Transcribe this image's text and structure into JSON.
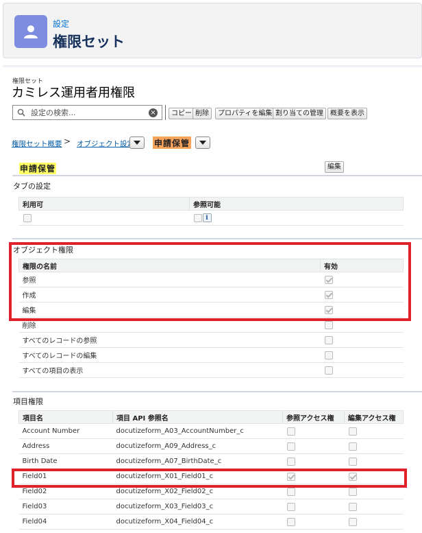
{
  "header": {
    "subtitle": "設定",
    "title": "権限セット"
  },
  "permission_set": {
    "label": "権限セット",
    "name": "カミレス運用者用権限"
  },
  "toolbar": {
    "search_placeholder": "設定の検索...",
    "buttons": [
      "コピー",
      "削除",
      "プロパティを編集",
      "割り当ての管理",
      "概要を表示"
    ]
  },
  "breadcrumb": {
    "item1": "権限セット概要",
    "item2": "オブジェクト設定",
    "current": "申請保管"
  },
  "object": {
    "name": "申請保管",
    "edit_label": "編集"
  },
  "tab_settings": {
    "title": "タブの設定",
    "col_available": "利用可",
    "col_visible": "参照可能",
    "info_icon_text": "i",
    "available_checked": false,
    "visible_checked": false
  },
  "object_permissions": {
    "title": "オブジェクト権限",
    "col_name": "権限の名前",
    "col_enabled": "有効",
    "rows": [
      {
        "name": "参照",
        "enabled": true
      },
      {
        "name": "作成",
        "enabled": true
      },
      {
        "name": "編集",
        "enabled": true
      },
      {
        "name": "削除",
        "enabled": false
      },
      {
        "name": "すべてのレコードの参照",
        "enabled": false
      },
      {
        "name": "すべてのレコードの編集",
        "enabled": false
      },
      {
        "name": "すべての項目の表示",
        "enabled": false
      }
    ]
  },
  "field_permissions": {
    "title": "項目権限",
    "col_field": "項目名",
    "col_api": "項目 API 参照名",
    "col_read": "参照アクセス権",
    "col_edit": "編集アクセス権",
    "rows": [
      {
        "field": "Account Number",
        "api": "docutizeform_A03_AccountNumber_c",
        "read": false,
        "edit": false
      },
      {
        "field": "Address",
        "api": "docutizeform_A09_Address_c",
        "read": false,
        "edit": false
      },
      {
        "field": "Birth Date",
        "api": "docutizeform_A07_BirthDate_c",
        "read": false,
        "edit": false
      },
      {
        "field": "Field01",
        "api": "docutizeform_X01_Field01_c",
        "read": true,
        "edit": true
      },
      {
        "field": "Field02",
        "api": "docutizeform_X02_Field02_c",
        "read": false,
        "edit": false
      },
      {
        "field": "Field03",
        "api": "docutizeform_X03_Field03_c",
        "read": false,
        "edit": false
      },
      {
        "field": "Field04",
        "api": "docutizeform_X04_Field04_c",
        "read": false,
        "edit": false
      }
    ]
  },
  "colors": {
    "highlight_box": "#e0202a",
    "header_icon_bg": "#7f8de1",
    "breadcrumb_current_bg": "#f7a35c",
    "object_name_bg": "#ffff66",
    "link": "#015ba7"
  }
}
